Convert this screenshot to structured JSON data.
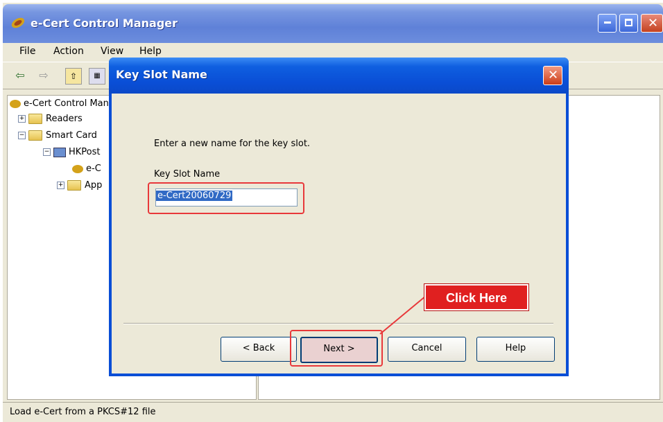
{
  "window": {
    "title": "e-Cert Control Manager"
  },
  "menu": [
    "File",
    "Action",
    "View",
    "Help"
  ],
  "tree": {
    "root": "e-Cert Control Manager",
    "readers": "Readers",
    "smart_cards": "Smart Card",
    "hkpost": "HKPost",
    "ecert": "e-C",
    "app": "App"
  },
  "dialog": {
    "title": "Key Slot Name",
    "prompt": "Enter a new name for the key slot.",
    "field_label": "Key Slot Name",
    "field_value": "e-Cert20060729",
    "buttons": {
      "back": "< Back",
      "next": "Next >",
      "cancel": "Cancel",
      "help": "Help"
    }
  },
  "callout": {
    "label": "Click Here"
  },
  "status": {
    "text": "Load e-Cert from a PKCS#12 file"
  },
  "colors": {
    "highlight": "#e8383a",
    "titlebar": "#0a4ed6"
  },
  "icons": [
    "app-icon",
    "back-arrow-icon",
    "forward-arrow-icon",
    "up-folder-icon",
    "folder-icon",
    "close-icon"
  ]
}
